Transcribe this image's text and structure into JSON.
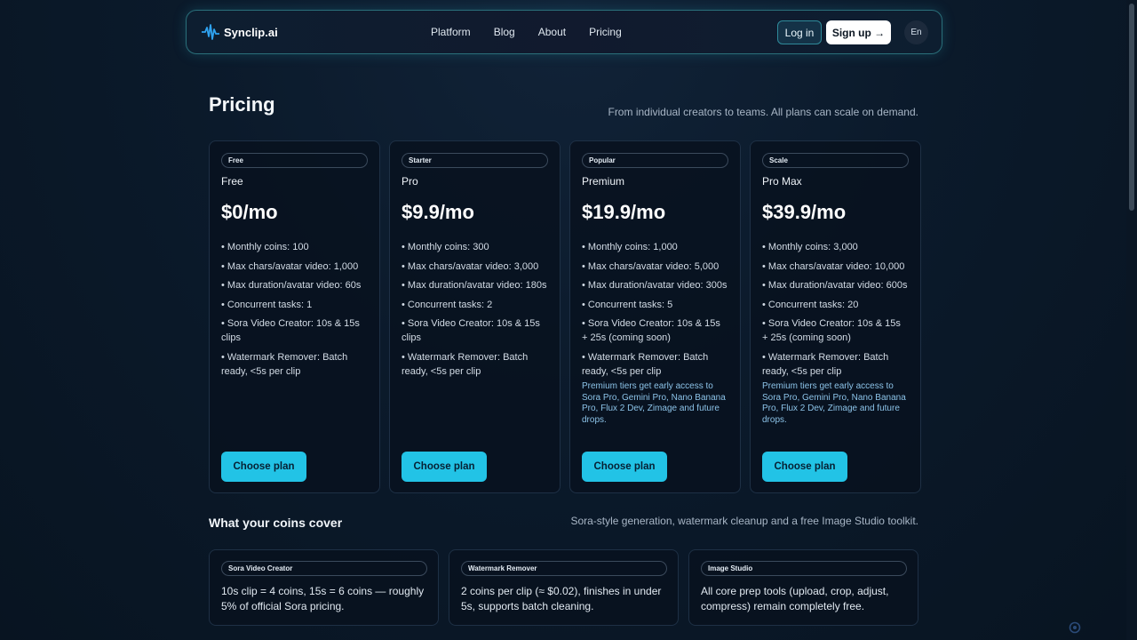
{
  "nav": {
    "brand": "Synclip.ai",
    "links": [
      "Platform",
      "Blog",
      "About",
      "Pricing"
    ],
    "login": "Log in",
    "signup": "Sign up →",
    "lang": "En"
  },
  "header": {
    "title": "Pricing",
    "subtitle": "From individual creators to teams. All plans can scale on demand."
  },
  "plans": [
    {
      "badge": "Free",
      "name": "Free",
      "price": "$0/mo",
      "features": [
        "• Monthly coins: 100",
        "• Max chars/avatar video: 1,000",
        "• Max duration/avatar video: 60s",
        "• Concurrent tasks: 1",
        "• Sora Video Creator: 10s & 15s clips",
        "• Watermark Remover: Batch ready, <5s per clip"
      ],
      "note": "",
      "cta": "Choose plan"
    },
    {
      "badge": "Starter",
      "name": "Pro",
      "price": "$9.9/mo",
      "features": [
        "• Monthly coins: 300",
        "• Max chars/avatar video: 3,000",
        "• Max duration/avatar video: 180s",
        "• Concurrent tasks: 2",
        "• Sora Video Creator: 10s & 15s clips",
        "• Watermark Remover: Batch ready, <5s per clip"
      ],
      "note": "",
      "cta": "Choose plan"
    },
    {
      "badge": "Popular",
      "name": "Premium",
      "price": "$19.9/mo",
      "features": [
        "• Monthly coins: 1,000",
        "• Max chars/avatar video: 5,000",
        "• Max duration/avatar video: 300s",
        "• Concurrent tasks: 5",
        "• Sora Video Creator: 10s & 15s + 25s (coming soon)",
        "• Watermark Remover: Batch ready, <5s per clip"
      ],
      "note": "Premium tiers get early access to Sora Pro, Gemini Pro, Nano Banana Pro, Flux 2 Dev, Zimage and future drops.",
      "cta": "Choose plan"
    },
    {
      "badge": "Scale",
      "name": "Pro Max",
      "price": "$39.9/mo",
      "features": [
        "• Monthly coins: 3,000",
        "• Max chars/avatar video: 10,000",
        "• Max duration/avatar video: 600s",
        "• Concurrent tasks: 20",
        "• Sora Video Creator: 10s & 15s + 25s (coming soon)",
        "• Watermark Remover: Batch ready, <5s per clip"
      ],
      "note": "Premium tiers get early access to Sora Pro, Gemini Pro, Nano Banana Pro, Flux 2 Dev, Zimage and future drops.",
      "cta": "Choose plan"
    }
  ],
  "coins": {
    "title": "What your coins cover",
    "subtitle": "Sora-style generation, watermark cleanup and a free Image Studio toolkit.",
    "cards": [
      {
        "badge": "Sora Video Creator",
        "text": "10s clip = 4 coins, 15s = 6 coins — roughly 5% of official Sora pricing."
      },
      {
        "badge": "Watermark Remover",
        "text": "2 coins per clip (≈ $0.02), finishes in under 5s, supports batch cleaning."
      },
      {
        "badge": "Image Studio",
        "text": "All core prep tools (upload, crop, adjust, compress) remain completely free."
      }
    ]
  },
  "colors": {
    "accent": "#22c3e6",
    "background": "#0b1a2b",
    "note": "#8cc3e8"
  },
  "icons": [
    "waveform-logo-icon",
    "recaptcha-icon"
  ]
}
